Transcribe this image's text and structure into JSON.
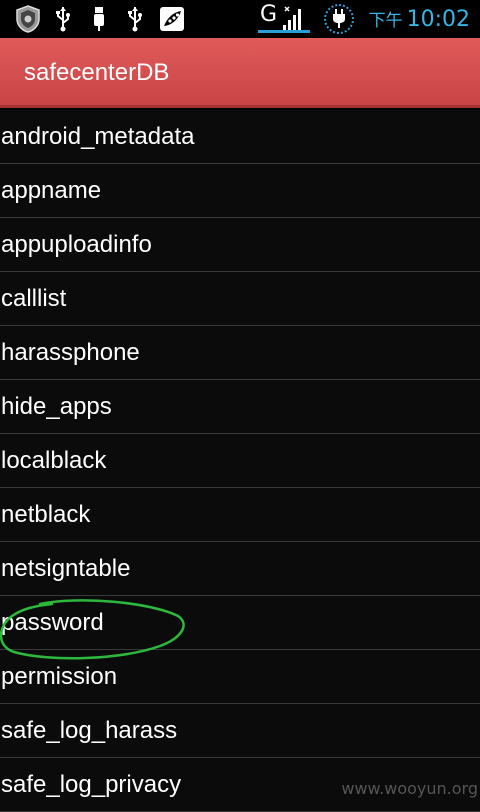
{
  "status_bar": {
    "left_icons": [
      "shield-icon",
      "usb-icon",
      "usb-icon",
      "usb-icon",
      "peapod-icon"
    ],
    "network_type": "G",
    "time_prefix": "下午",
    "time": "10:02",
    "accent_color": "#33b5e5"
  },
  "title_bar": {
    "title": "safecenterDB",
    "color": "#d94f4f"
  },
  "tables": [
    "android_metadata",
    "appname",
    "appuploadinfo",
    "calllist",
    "harassphone",
    "hide_apps",
    "localblack",
    "netblack",
    "netsigntable",
    "password",
    "permission",
    "safe_log_harass",
    "safe_log_privacy"
  ],
  "annotation": {
    "highlighted_item": "password",
    "color": "#2db83d"
  },
  "watermark": "www.wooyun.org"
}
